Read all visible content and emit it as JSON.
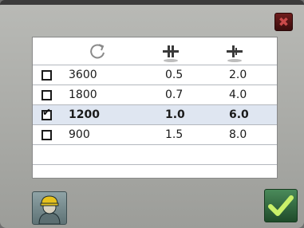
{
  "header": {
    "icons": [
      "rotation-speed-icon",
      "engagement-pressure-icon",
      "hold-pressure-icon"
    ]
  },
  "rows": [
    {
      "checked": false,
      "speed": "3600",
      "val1": "0.5",
      "val2": "2.0"
    },
    {
      "checked": false,
      "speed": "1800",
      "val1": "0.7",
      "val2": "4.0"
    },
    {
      "checked": true,
      "speed": "1200",
      "val1": "1.0",
      "val2": "6.0"
    },
    {
      "checked": false,
      "speed": "900",
      "val1": "1.5",
      "val2": "8.0"
    }
  ],
  "controls": {
    "close_icon": "close-icon",
    "user_icon": "worker-helmet-icon",
    "confirm_icon": "checkmark-icon"
  },
  "colors": {
    "selected_row": "#dfe6f1",
    "confirm": "#2f6a3c",
    "close": "#5a1717"
  }
}
